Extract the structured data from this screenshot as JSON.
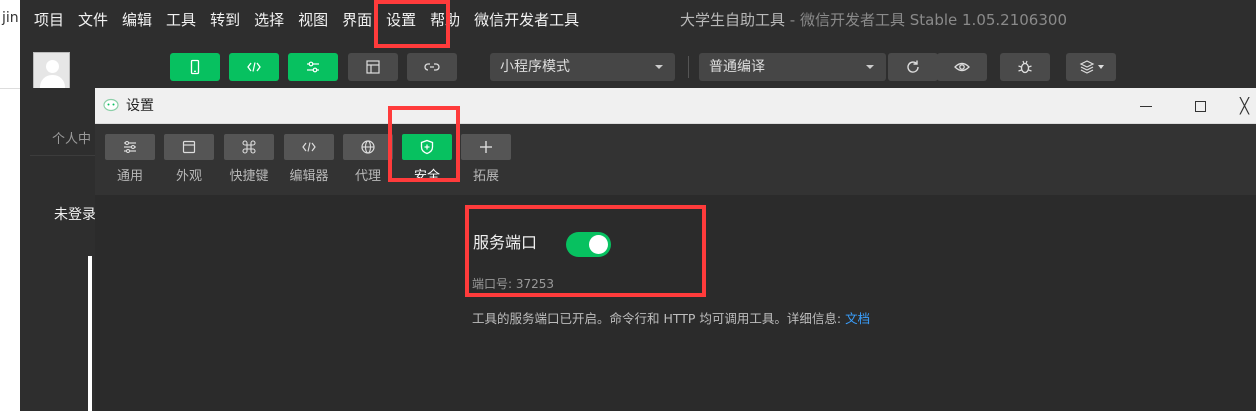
{
  "background": {
    "edge_text": "jin",
    "sidebar_tab": "个人中",
    "login_text": "未登录"
  },
  "menu": {
    "items": [
      "项目",
      "文件",
      "编辑",
      "工具",
      "转到",
      "选择",
      "视图",
      "界面",
      "设置",
      "帮助",
      "微信开发者工具"
    ],
    "app_title": "大学生自助工具",
    "app_subtitle": " - 微信开发者工具 Stable 1.05.2106300"
  },
  "toolbar": {
    "buttons": [
      {
        "name": "simulator",
        "icon": "phone-icon",
        "style": "green"
      },
      {
        "name": "editor",
        "icon": "code-icon",
        "style": "green"
      },
      {
        "name": "debugger",
        "icon": "sliders-icon",
        "style": "green"
      },
      {
        "name": "visual",
        "icon": "layout-icon",
        "style": "gray"
      },
      {
        "name": "cloud",
        "icon": "link-cloud-icon",
        "style": "gray"
      }
    ],
    "mode_select": "小程序模式",
    "compile_select": "普通编译",
    "right_buttons": [
      "refresh-icon",
      "preview-eye-icon",
      "debug-bug-icon",
      "layers-icon"
    ]
  },
  "dialog": {
    "title": "设置",
    "close_glyph": "╳",
    "tabs": [
      {
        "label": "通用",
        "icon": "sliders-icon",
        "active": false
      },
      {
        "label": "外观",
        "icon": "window-icon",
        "active": false
      },
      {
        "label": "快捷键",
        "icon": "command-icon",
        "active": false
      },
      {
        "label": "编辑器",
        "icon": "code-icon",
        "active": false
      },
      {
        "label": "代理",
        "icon": "globe-icon",
        "active": false
      },
      {
        "label": "安全",
        "icon": "shield-icon",
        "active": true
      },
      {
        "label": "拓展",
        "icon": "plus-icon",
        "active": false
      }
    ],
    "security": {
      "port_label": "服务端口",
      "port_enabled": true,
      "port_number_text": "端口号: 37253",
      "description": "工具的服务端口已开启。命令行和 HTTP 均可调用工具。详细信息: ",
      "doc_link": "文档"
    }
  },
  "colors": {
    "accent_green": "#07c160",
    "highlight_red": "#ff3b3b",
    "link_blue": "#3aa0ff"
  }
}
